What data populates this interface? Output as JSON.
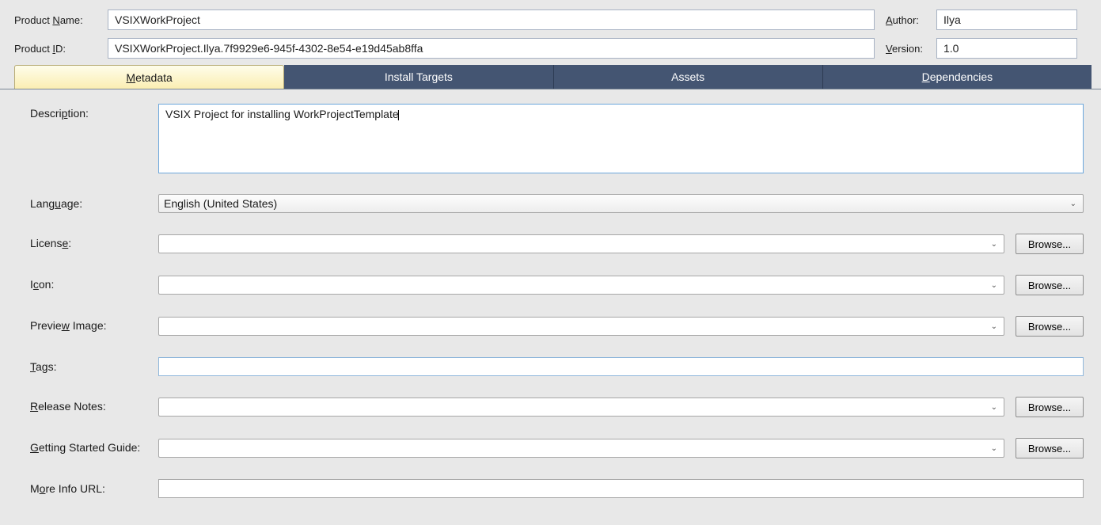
{
  "header": {
    "product_name_label_pre": "Product ",
    "product_name_label_u": "N",
    "product_name_label_post": "ame:",
    "product_name_value": "VSIXWorkProject",
    "author_label_u": "A",
    "author_label_post": "uthor:",
    "author_value": "Ilya",
    "product_id_label_pre": "Product ",
    "product_id_label_u": "I",
    "product_id_label_post": "D:",
    "product_id_value": "VSIXWorkProject.Ilya.7f9929e6-945f-4302-8e54-e19d45ab8ffa",
    "version_label_u": "V",
    "version_label_post": "ersion:",
    "version_value": "1.0"
  },
  "tabs": {
    "metadata_u": "M",
    "metadata_post": "etadata",
    "install": "Install Targets",
    "assets": "Assets",
    "deps_u": "D",
    "deps_post": "ependencies"
  },
  "form": {
    "description_label_pre": "Descri",
    "description_label_u": "p",
    "description_label_post": "tion:",
    "description_value": "VSIX Project for installing WorkProjectTemplate",
    "language_label_pre": "Lang",
    "language_label_u": "u",
    "language_label_post": "age:",
    "language_value": "English (United States)",
    "license_label_pre": "Licens",
    "license_label_u": "e",
    "license_label_post": ":",
    "icon_label_pre": "I",
    "icon_label_u": "c",
    "icon_label_post": "on:",
    "preview_label_pre": "Previe",
    "preview_label_u": "w",
    "preview_label_post": " Image:",
    "tags_label_u": "T",
    "tags_label_post": "ags:",
    "release_label_u": "R",
    "release_label_post": "elease Notes:",
    "gsg_label_u": "G",
    "gsg_label_post": "etting Started Guide:",
    "more_label_pre": "M",
    "more_label_u": "o",
    "more_label_post": "re Info URL:",
    "browse": "Browse..."
  }
}
